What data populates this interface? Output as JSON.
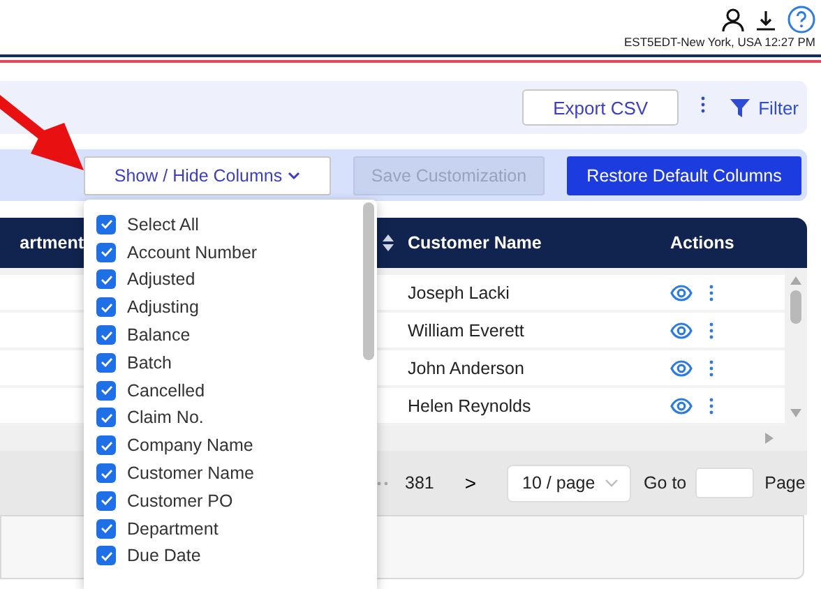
{
  "header": {
    "timezone_clock": "EST5EDT-New York, USA 12:27 PM"
  },
  "toolbar": {
    "export_button": "Export CSV",
    "filter_label": "Filter"
  },
  "column_bar": {
    "buttons": [
      {
        "label": "Show / Hide Columns",
        "kind": "dropdown"
      },
      {
        "label": "Save Customization",
        "kind": "disabled"
      },
      {
        "label": "Restore Default Columns",
        "kind": "primary"
      }
    ]
  },
  "table": {
    "columns": [
      "artment",
      "Customer Name",
      "Actions"
    ],
    "rows": [
      {
        "customer_name": "Joseph Lacki"
      },
      {
        "customer_name": "William Everett"
      },
      {
        "customer_name": "John Anderson"
      },
      {
        "customer_name": "Helen Reynolds"
      }
    ]
  },
  "pagination": {
    "last_page": "381",
    "next": ">",
    "page_size": "10 / page",
    "goto_label": "Go to",
    "page_label": "Page"
  },
  "column_menu": {
    "items": [
      {
        "label": "Select All",
        "checked": true
      },
      {
        "label": "Account Number",
        "checked": true
      },
      {
        "label": "Adjusted",
        "checked": true
      },
      {
        "label": "Adjusting",
        "checked": true
      },
      {
        "label": "Balance",
        "checked": true
      },
      {
        "label": "Batch",
        "checked": true
      },
      {
        "label": "Cancelled",
        "checked": true
      },
      {
        "label": "Claim No.",
        "checked": true
      },
      {
        "label": "Company Name",
        "checked": true
      },
      {
        "label": "Customer Name",
        "checked": true
      },
      {
        "label": "Customer PO",
        "checked": true
      },
      {
        "label": "Department",
        "checked": true
      },
      {
        "label": "Due Date",
        "checked": true
      }
    ]
  }
}
